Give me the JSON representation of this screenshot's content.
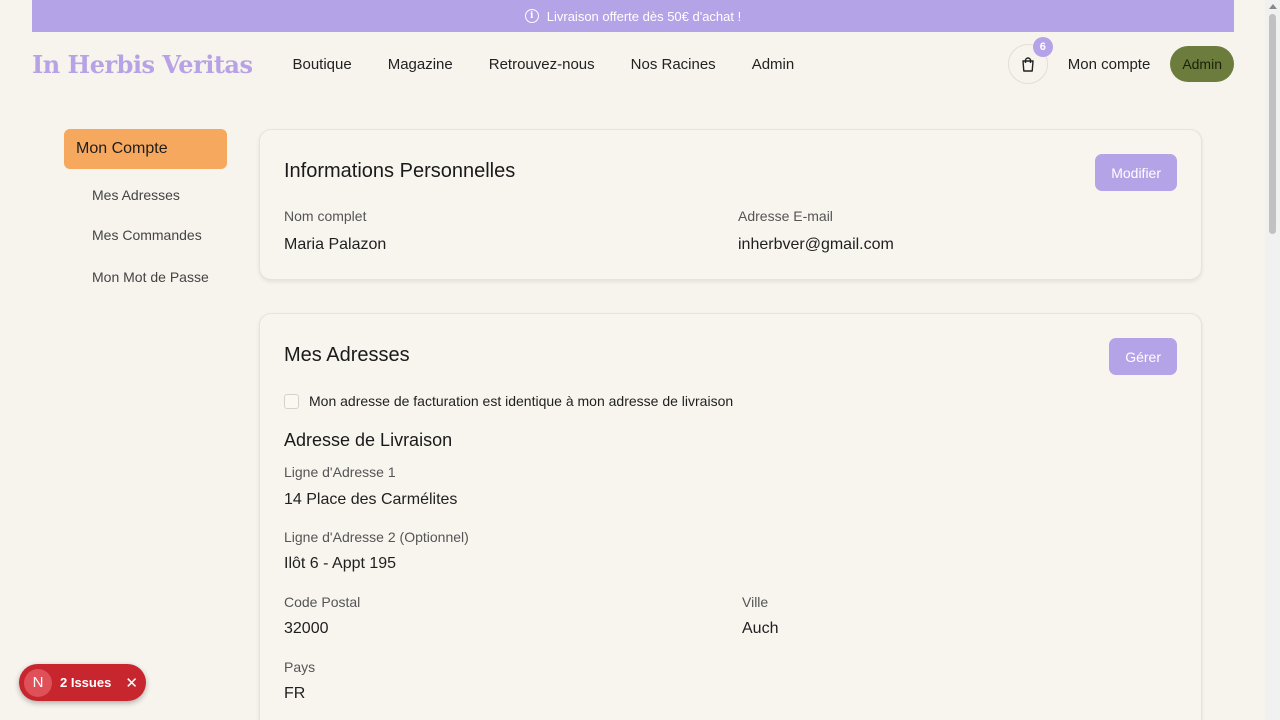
{
  "banner": {
    "text": "Livraison offerte dès 50€ d'achat !"
  },
  "header": {
    "logo": "In Herbis Veritas",
    "nav": [
      "Boutique",
      "Magazine",
      "Retrouvez-nous",
      "Nos Racines",
      "Admin"
    ],
    "cart_count": "6",
    "account_label": "Mon compte",
    "admin_label": "Admin"
  },
  "sidebar": {
    "active": "Mon Compte",
    "items": [
      "Mes Adresses",
      "Mes Commandes",
      "Mon Mot de Passe"
    ]
  },
  "personal": {
    "title": "Informations Personnelles",
    "edit_label": "Modifier",
    "name_label": "Nom complet",
    "name_value": "Maria Palazon",
    "email_label": "Adresse E-mail",
    "email_value": "inherbver@gmail.com"
  },
  "addresses": {
    "title": "Mes Adresses",
    "manage_label": "Gérer",
    "same_billing_label": "Mon adresse de facturation est identique à mon adresse de livraison",
    "same_billing_checked": false,
    "shipping_title": "Adresse de Livraison",
    "line1_label": "Ligne d'Adresse 1",
    "line1_value": "14 Place des Carmélites",
    "line2_label": "Ligne d'Adresse 2 (Optionnel)",
    "line2_value": "Ilôt 6 - Appt 195",
    "postal_label": "Code Postal",
    "postal_value": "32000",
    "city_label": "Ville",
    "city_value": "Auch",
    "country_label": "Pays",
    "country_value": "FR"
  },
  "issues_badge": {
    "letter": "N",
    "text": "2 Issues"
  },
  "colors": {
    "accent": "#b5a3e8",
    "sidebar_active": "#f6a95e",
    "admin_button": "#6b7c3c",
    "issues": "#c7262f"
  }
}
